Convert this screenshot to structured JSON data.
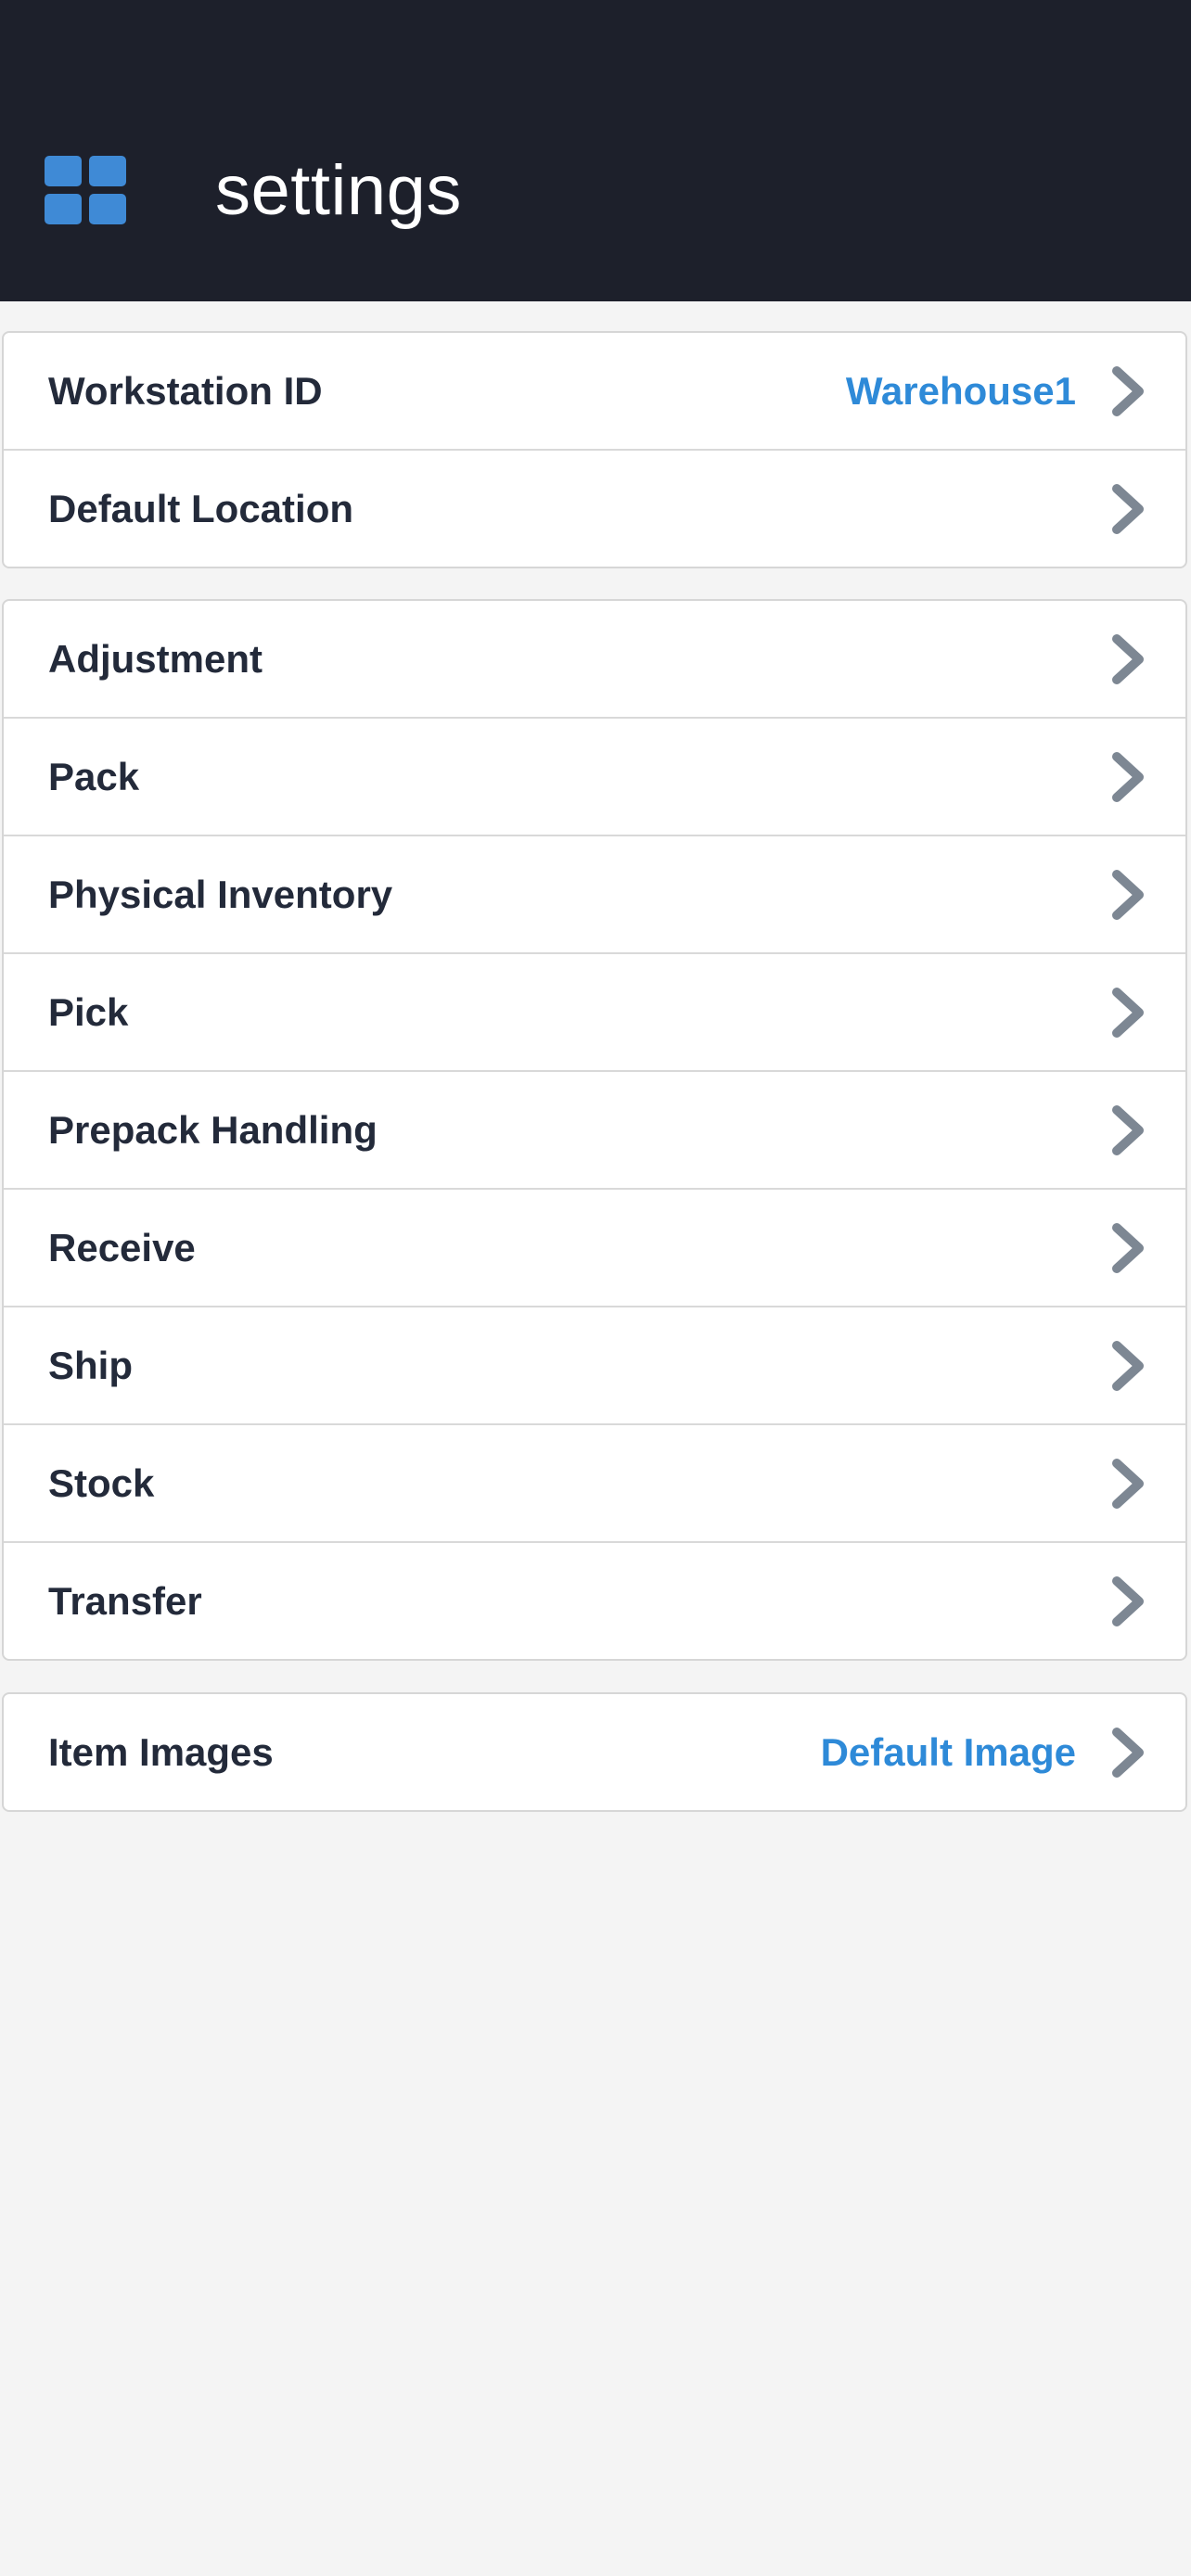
{
  "header": {
    "title": "settings",
    "apps_icon": "grid-apps-icon",
    "background_color": "#1d202b",
    "icon_color": "#3f8ad6"
  },
  "groups": [
    {
      "rows": [
        {
          "label": "Workstation ID",
          "value": "Warehouse1"
        },
        {
          "label": "Default Location",
          "value": ""
        }
      ]
    },
    {
      "rows": [
        {
          "label": "Adjustment",
          "value": ""
        },
        {
          "label": "Pack",
          "value": ""
        },
        {
          "label": "Physical Inventory",
          "value": ""
        },
        {
          "label": "Pick",
          "value": ""
        },
        {
          "label": "Prepack Handling",
          "value": ""
        },
        {
          "label": "Receive",
          "value": ""
        },
        {
          "label": "Ship",
          "value": ""
        },
        {
          "label": "Stock",
          "value": ""
        },
        {
          "label": "Transfer",
          "value": ""
        }
      ]
    },
    {
      "rows": [
        {
          "label": "Item Images",
          "value": "Default Image"
        }
      ]
    }
  ],
  "colors": {
    "accent": "#2e8ad8",
    "label": "#232a3a",
    "chevron": "#7d8793",
    "page_background": "#f4f4f4"
  },
  "icons": {
    "row_chevron": "chevron-right-icon"
  }
}
